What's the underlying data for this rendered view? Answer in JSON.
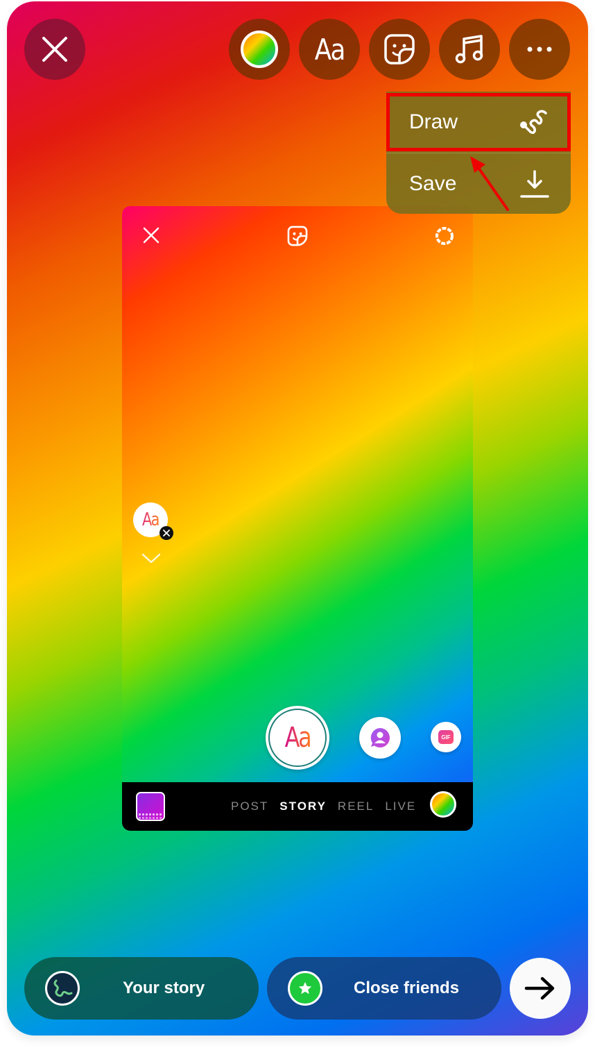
{
  "toolbar": {
    "close_icon": "close-icon",
    "items": [
      {
        "name": "color-picker",
        "icon": "rainbow-circle-icon"
      },
      {
        "name": "text",
        "label": "Aa"
      },
      {
        "name": "sticker",
        "icon": "sticker-icon"
      },
      {
        "name": "music",
        "icon": "music-note-icon"
      },
      {
        "name": "more",
        "icon": "more-icon"
      }
    ]
  },
  "menu": {
    "items": [
      {
        "label": "Draw",
        "icon": "squiggle-draw-icon",
        "highlighted": true
      },
      {
        "label": "Save",
        "icon": "download-icon"
      }
    ]
  },
  "annotation": {
    "highlight_color": "#ee0000"
  },
  "preview": {
    "text_sticker_label": "Aa",
    "create_button_label": "Aa",
    "gif_label": "GIF",
    "modes": [
      "POST",
      "STORY",
      "REEL",
      "LIVE"
    ],
    "active_mode": "STORY"
  },
  "share": {
    "your_story_label": "Your story",
    "close_friends_label": "Close friends",
    "close_friends_color": "#1ec93b"
  }
}
